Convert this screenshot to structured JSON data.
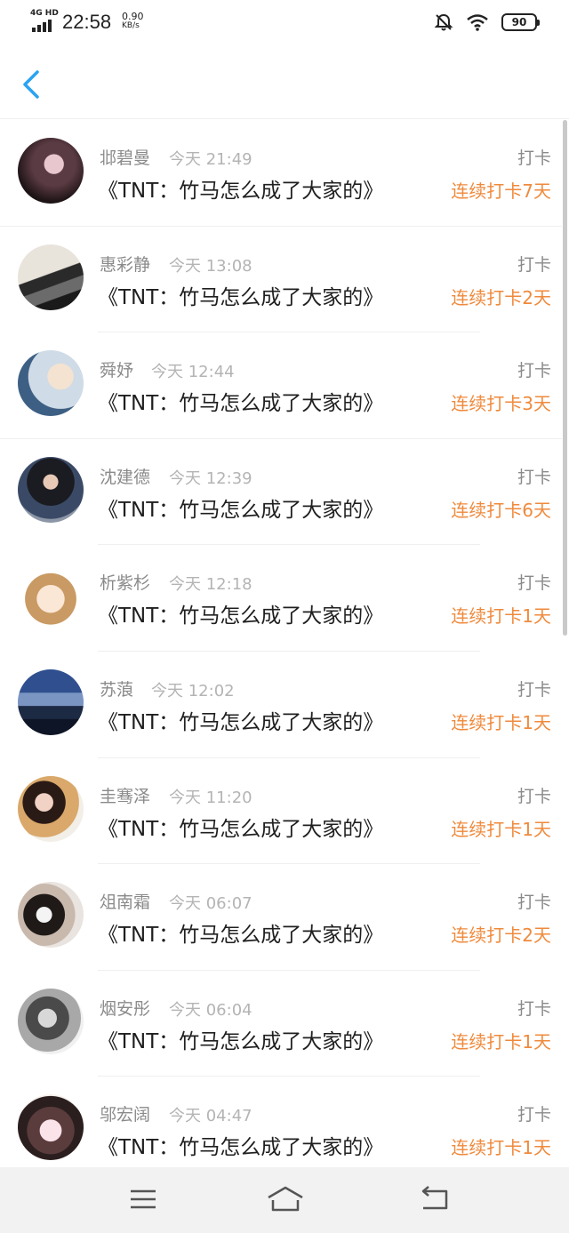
{
  "status_bar": {
    "network": "4G HD",
    "time": "22:58",
    "speed_value": "0.90",
    "speed_unit": "KB/s",
    "battery": "90",
    "icons": [
      "signal-icon",
      "mute-bell-icon",
      "wifi-icon",
      "battery-icon"
    ]
  },
  "nav": {
    "back_icon": "chevron-left-icon"
  },
  "entries": [
    {
      "name": "邶碧曼",
      "time": "今天 21:49",
      "title": "《TNT：竹马怎么成了大家的》",
      "action": "打卡",
      "streak": "连续打卡7天"
    },
    {
      "name": "惠彩静",
      "time": "今天 13:08",
      "title": "《TNT：竹马怎么成了大家的》",
      "action": "打卡",
      "streak": "连续打卡2天"
    },
    {
      "name": "舜妤",
      "time": "今天 12:44",
      "title": "《TNT：竹马怎么成了大家的》",
      "action": "打卡",
      "streak": "连续打卡3天"
    },
    {
      "name": "沈建德",
      "time": "今天 12:39",
      "title": "《TNT：竹马怎么成了大家的》",
      "action": "打卡",
      "streak": "连续打卡6天"
    },
    {
      "name": "析紫杉",
      "time": "今天 12:18",
      "title": "《TNT：竹马怎么成了大家的》",
      "action": "打卡",
      "streak": "连续打卡1天"
    },
    {
      "name": "苏蒗",
      "time": "今天 12:02",
      "title": "《TNT：竹马怎么成了大家的》",
      "action": "打卡",
      "streak": "连续打卡1天"
    },
    {
      "name": "圭骞泽",
      "time": "今天 11:20",
      "title": "《TNT：竹马怎么成了大家的》",
      "action": "打卡",
      "streak": "连续打卡1天"
    },
    {
      "name": "俎南霜",
      "time": "今天 06:07",
      "title": "《TNT：竹马怎么成了大家的》",
      "action": "打卡",
      "streak": "连续打卡2天"
    },
    {
      "name": "烟安彤",
      "time": "今天 06:04",
      "title": "《TNT：竹马怎么成了大家的》",
      "action": "打卡",
      "streak": "连续打卡1天"
    },
    {
      "name": "邬宏阔",
      "time": "今天 04:47",
      "title": "《TNT：竹马怎么成了大家的》",
      "action": "打卡",
      "streak": "连续打卡1天"
    }
  ],
  "bottom_nav": {
    "icons": [
      "menu-icon",
      "home-icon",
      "back-icon"
    ]
  },
  "colors": {
    "accent": "#ef8a3c",
    "back_arrow": "#2aa3f0"
  }
}
